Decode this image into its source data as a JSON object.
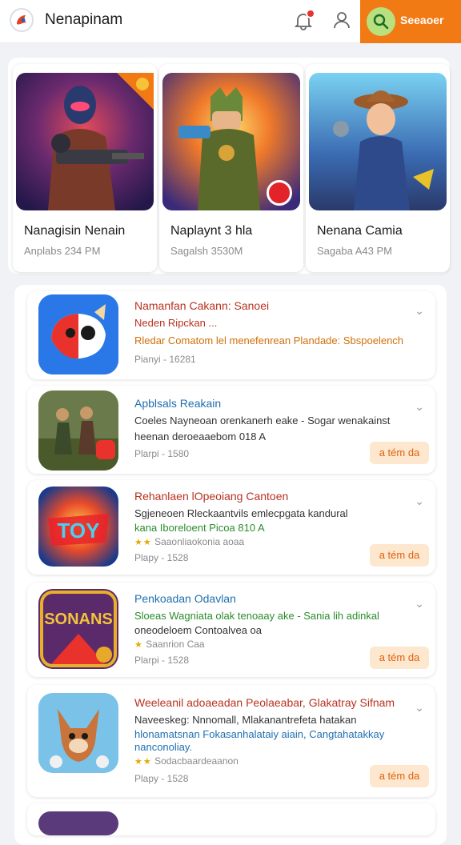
{
  "header": {
    "app_name": "Nenapinam",
    "search_label": "Seeaoer",
    "icons": [
      "app-logo-icon",
      "bell-icon",
      "user-icon",
      "search-icon"
    ],
    "accent": "#f27a14"
  },
  "featured": [
    {
      "name": "Nanagisin Nenain",
      "sub": "Anplabs 234 PM"
    },
    {
      "name": "Naplaynt 3 hla",
      "sub": "Sagalsh 3530M"
    },
    {
      "name": "Nenana Camia",
      "sub": "Sagaba A43 PM"
    }
  ],
  "list": [
    {
      "title": "Namanfan Cakann: Sanoei",
      "line1": "Neden Ripckan ...",
      "line2": "Rledar Comatom lel menefenrean Plandade: Sbspoelench",
      "meta": "Pianyi - 16281"
    },
    {
      "title": "Apblsals Reakain",
      "line1": "Coeles Nayneoan orenkanerh eake - Sogar wenakainst",
      "line2": "heenan deroeaaebom 018 A",
      "meta": "Plarpi - 1580",
      "badge": "a tém da"
    },
    {
      "title": "Rehanlaen lOpeoiang Cantoen",
      "line1": "Sgjeneoen Rleckaantvils emlecpgata kandural",
      "line2": "kana Iboreloent Picoa 810 A",
      "line3": "Saaonliaokonia aoaa",
      "meta": "Plapy - 1528",
      "badge": "a tém da"
    },
    {
      "title": "Penkoadan Odavlan",
      "line1": "Sloeas Wagniata olak tenoaay ake - Sania lih adinkal",
      "line2": "oneodeloem Contoalvea oa",
      "line3": "Saanrion Caa",
      "meta": "Plarpi - 1528",
      "badge": "a tém da"
    },
    {
      "title": "Weeleanil adoaeadan Peolaeabar, Glakatray Sifnam",
      "line1": "Naveeskeg: Nnnomall, Mlakanantrefeta hatakan",
      "line2": "hlonamatsnan Fokasanhalataiy aiain, Cangtahatakkay",
      "line3": "nanconoliay.",
      "line4": "Sodacbaardeaanon",
      "meta": "Plapy - 1528",
      "badge": "a tém da"
    }
  ]
}
